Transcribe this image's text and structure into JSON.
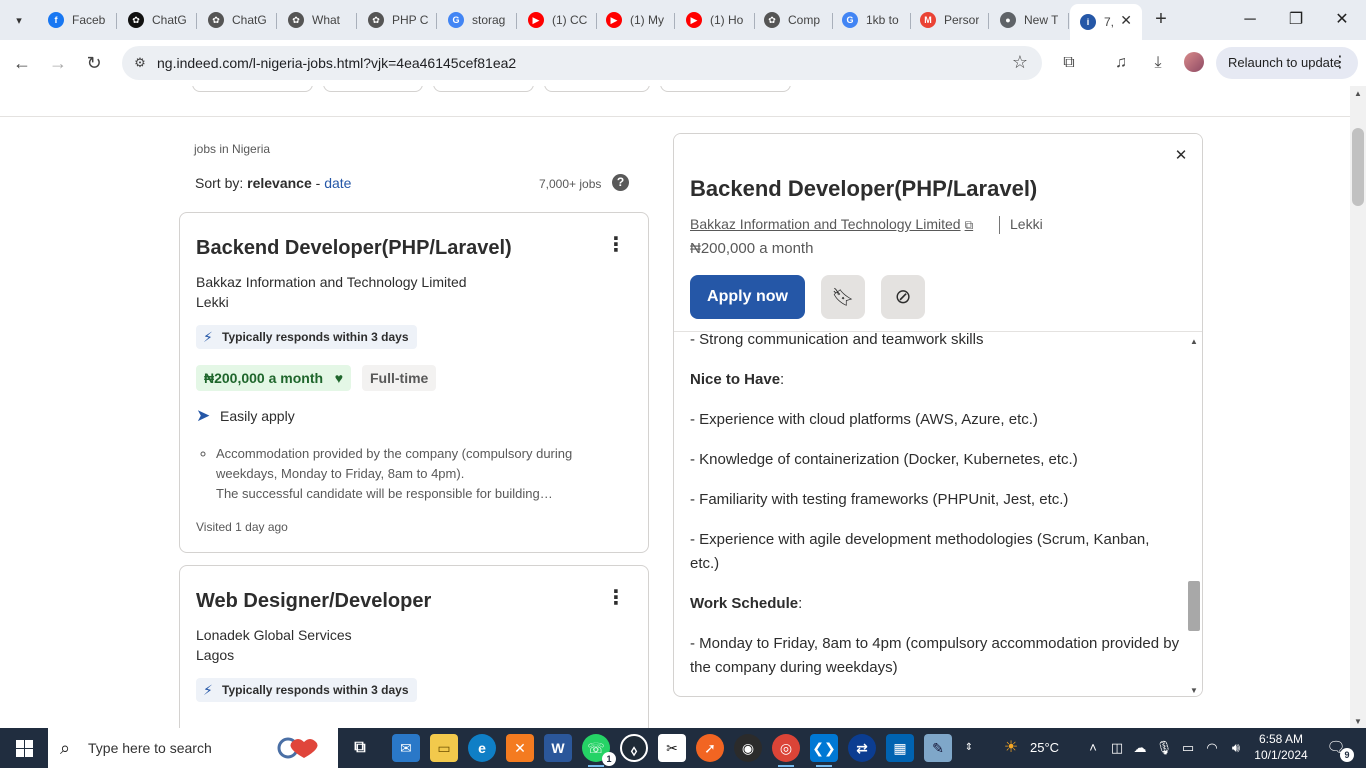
{
  "browser": {
    "tabs": [
      {
        "title": "Faceb",
        "favicon": "facebook-icon",
        "color": "#1877f2",
        "glyph": "f"
      },
      {
        "title": "ChatG",
        "favicon": "chatgpt-icon",
        "color": "#111111",
        "glyph": "✿"
      },
      {
        "title": "ChatG",
        "favicon": "chatgpt-icon",
        "color": "#555555",
        "glyph": "✿"
      },
      {
        "title": "What",
        "favicon": "chatgpt-icon",
        "color": "#555555",
        "glyph": "✿"
      },
      {
        "title": "PHP C",
        "favicon": "chatgpt-icon",
        "color": "#555555",
        "glyph": "✿"
      },
      {
        "title": "storag",
        "favicon": "google-icon",
        "color": "#4285f4",
        "glyph": "G"
      },
      {
        "title": "(1) CC",
        "favicon": "youtube-icon",
        "color": "#ff0000",
        "glyph": "▶"
      },
      {
        "title": "(1) My",
        "favicon": "youtube-icon",
        "color": "#ff0000",
        "glyph": "▶"
      },
      {
        "title": "(1) Ho",
        "favicon": "youtube-icon",
        "color": "#ff0000",
        "glyph": "▶"
      },
      {
        "title": "Comp",
        "favicon": "chatgpt-icon",
        "color": "#555555",
        "glyph": "✿"
      },
      {
        "title": "1kb to",
        "favicon": "google-icon",
        "color": "#4285f4",
        "glyph": "G"
      },
      {
        "title": "Persor",
        "favicon": "gmail-icon",
        "color": "#ea4335",
        "glyph": "M"
      },
      {
        "title": "New T",
        "favicon": "chrome-icon",
        "color": "#5f6368",
        "glyph": "●"
      },
      {
        "title": "7,",
        "favicon": "indeed-icon",
        "color": "#2557a7",
        "glyph": "i"
      }
    ],
    "url": "ng.indeed.com/l-nigeria-jobs.html?vjk=4ea46145cef81ea2",
    "relaunch_label": "Relaunch to update"
  },
  "results": {
    "breadcrumb": "jobs in Nigeria",
    "sort_prefix": "Sort by: ",
    "sort_active": "relevance",
    "sort_dash": " - ",
    "sort_other": "date",
    "count": "7,000+ jobs",
    "help_glyph": "?",
    "cards": [
      {
        "title": "Backend Developer(PHP/Laravel)",
        "company": "Bakkaz Information and Technology Limited",
        "location": "Lekki",
        "responds": "Typically responds within 3 days",
        "salary": "₦200,000 a month",
        "job_type": "Full-time",
        "easy_apply": "Easily apply",
        "snippets": [
          "Accommodation provided by the company (compulsory during weekdays, Monday to Friday, 8am to 4pm).",
          "The successful candidate will be responsible for building…"
        ],
        "visited": "Visited 1 day ago"
      },
      {
        "title": "Web Designer/Developer",
        "company": "Lonadek Global Services",
        "location": "Lagos",
        "responds": "Typically responds within 3 days"
      }
    ]
  },
  "detail": {
    "title": "Backend Developer(PHP/Laravel)",
    "company": "Bakkaz Information and Technology Limited",
    "location": "Lekki",
    "salary": "₦200,000 a month",
    "apply_label": "Apply now",
    "body": {
      "line1": "- Strong communication and teamwork skills",
      "nice_heading": "Nice to Have",
      "nice_items": [
        "- Experience with cloud platforms (AWS, Azure, etc.)",
        "- Knowledge of containerization (Docker, Kubernetes, etc.)",
        "- Familiarity with testing frameworks (PHPUnit, Jest, etc.)",
        "- Experience with agile development methodologies (Scrum, Kanban, etc.)"
      ],
      "schedule_heading": "Work Schedule",
      "schedule_item": "- Monday to Friday, 8am to 4pm (compulsory accommodation provided by the company during weekdays)"
    }
  },
  "taskbar": {
    "search_placeholder": "Type here to search",
    "weather": "25°C",
    "time": "6:58 AM",
    "date": "10/1/2024",
    "notifications": "9",
    "whatsapp_badge": "1"
  }
}
